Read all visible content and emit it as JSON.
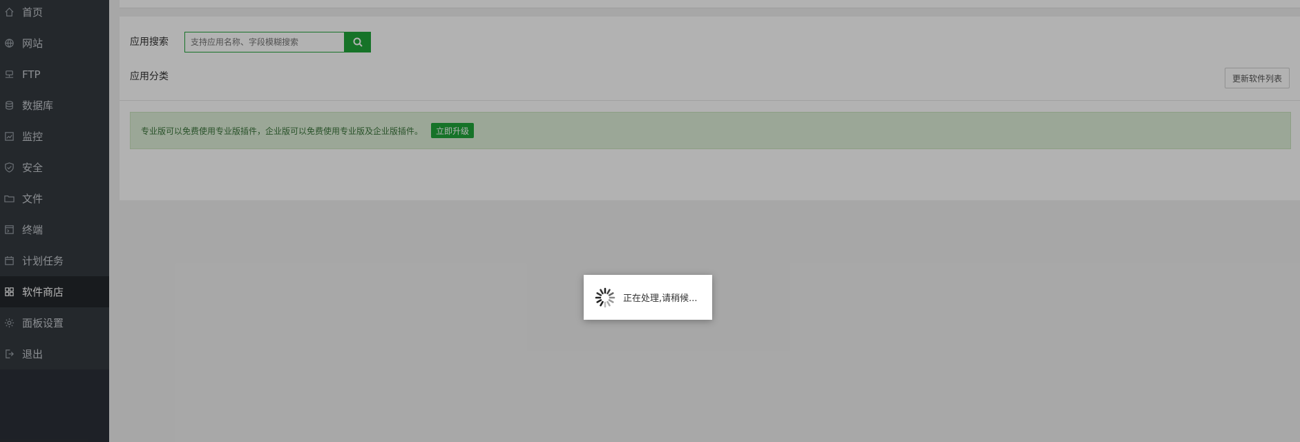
{
  "sidebar": {
    "items": [
      {
        "label": "首页",
        "icon": "home-icon",
        "active": false
      },
      {
        "label": "网站",
        "icon": "globe-icon",
        "active": false
      },
      {
        "label": "FTP",
        "icon": "ftp-server-icon",
        "active": false
      },
      {
        "label": "数据库",
        "icon": "database-icon",
        "active": false
      },
      {
        "label": "监控",
        "icon": "monitor-chart-icon",
        "active": false
      },
      {
        "label": "安全",
        "icon": "shield-icon",
        "active": false
      },
      {
        "label": "文件",
        "icon": "folder-icon",
        "active": false
      },
      {
        "label": "终端",
        "icon": "terminal-icon",
        "active": false
      },
      {
        "label": "计划任务",
        "icon": "calendar-icon",
        "active": false
      },
      {
        "label": "软件商店",
        "icon": "grid-apps-icon",
        "active": true
      },
      {
        "label": "面板设置",
        "icon": "gear-icon",
        "active": false
      },
      {
        "label": "退出",
        "icon": "logout-icon",
        "active": false
      }
    ]
  },
  "search": {
    "label": "应用搜索",
    "placeholder": "支持应用名称、字段模糊搜索",
    "value": ""
  },
  "category": {
    "label": "应用分类"
  },
  "update_button": "更新软件列表",
  "notice": {
    "text": "专业版可以免费使用专业版插件，企业版可以免费使用专业版及企业版插件。",
    "button": "立即升级"
  },
  "loading": {
    "text": "正在处理,请稍候..."
  },
  "colors": {
    "accent": "#20a53a",
    "sidebar_bg": "#343a40",
    "sidebar_active_bg": "#23272c",
    "notice_bg": "#dff0d8",
    "notice_text": "#3c763d"
  }
}
